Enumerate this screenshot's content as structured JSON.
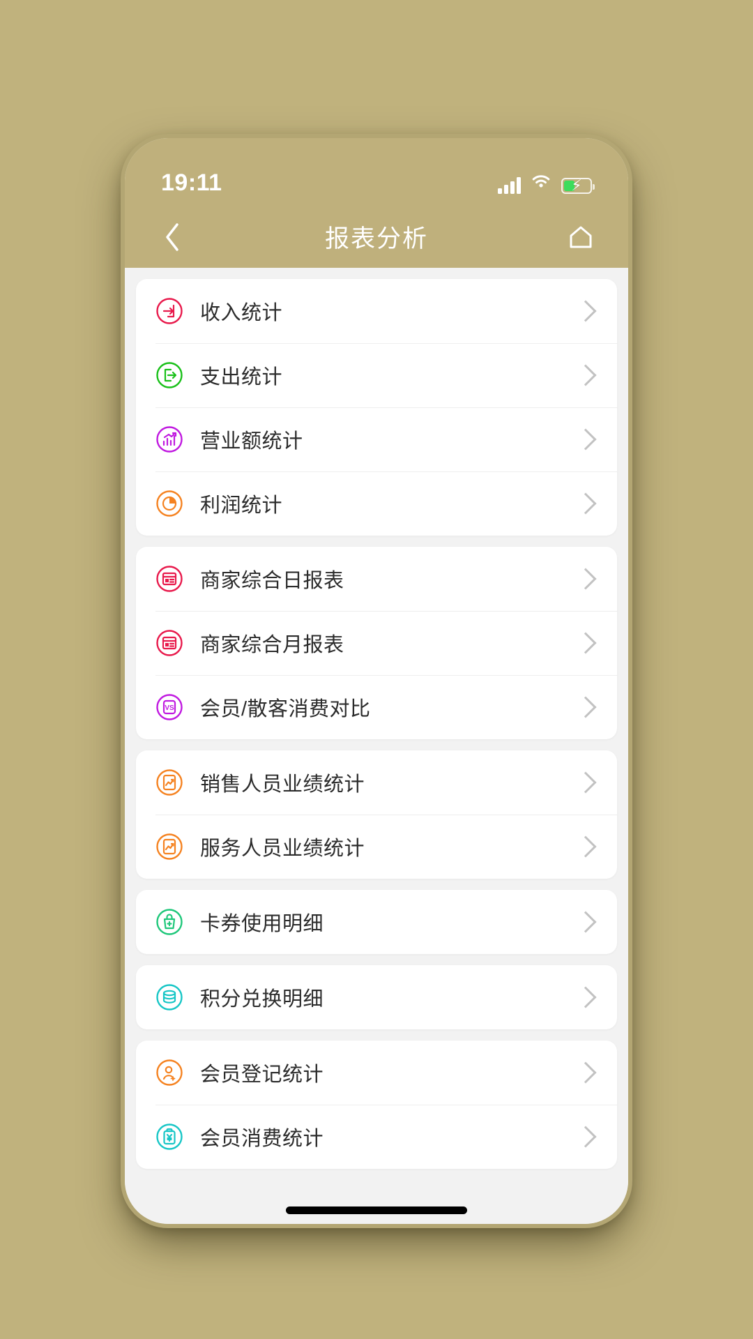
{
  "status_bar": {
    "time": "19:11",
    "signal_icon": "signal-bars-icon",
    "wifi_icon": "wifi-icon",
    "battery_icon": "battery-charging-icon",
    "battery_level_percent": 42,
    "battery_fill_color": "#3ddc5c"
  },
  "nav": {
    "back_icon": "chevron-left-icon",
    "title": "报表分析",
    "home_icon": "home-icon",
    "background_color": "#bfb07c",
    "text_color": "#ffffff"
  },
  "theme": {
    "page_background": "#f2f2f2",
    "wallpaper": "#c0b27d",
    "card_background": "#ffffff",
    "chevron_color": "#c2c2c2"
  },
  "groups": [
    {
      "items": [
        {
          "label": "收入统计",
          "icon": "income-arrow-in-icon",
          "color": "#e8194b"
        },
        {
          "label": "支出统计",
          "icon": "expense-arrow-out-icon",
          "color": "#18c018"
        },
        {
          "label": "营业额统计",
          "icon": "bar-chart-growth-icon",
          "color": "#c019e0"
        },
        {
          "label": "利润统计",
          "icon": "pie-chart-icon",
          "color": "#f58220"
        }
      ]
    },
    {
      "items": [
        {
          "label": "商家综合日报表",
          "icon": "daily-report-icon",
          "color": "#e8194b"
        },
        {
          "label": "商家综合月报表",
          "icon": "monthly-report-icon",
          "color": "#e8194b"
        },
        {
          "label": "会员/散客消费对比",
          "icon": "versus-compare-icon",
          "color": "#c019e0"
        }
      ]
    },
    {
      "items": [
        {
          "label": "销售人员业绩统计",
          "icon": "sales-performance-icon",
          "color": "#f58220"
        },
        {
          "label": "服务人员业绩统计",
          "icon": "service-performance-icon",
          "color": "#f58220"
        }
      ]
    },
    {
      "items": [
        {
          "label": "卡券使用明细",
          "icon": "coupon-gift-icon",
          "color": "#1ec77a"
        }
      ]
    },
    {
      "items": [
        {
          "label": "积分兑换明细",
          "icon": "points-coins-icon",
          "color": "#17c6c6"
        }
      ]
    },
    {
      "items": [
        {
          "label": "会员登记统计",
          "icon": "member-register-icon",
          "color": "#f58220"
        },
        {
          "label": "会员消费统计",
          "icon": "member-consumption-icon",
          "color": "#17c6c6"
        }
      ]
    }
  ],
  "home_indicator": "home-indicator-bar"
}
